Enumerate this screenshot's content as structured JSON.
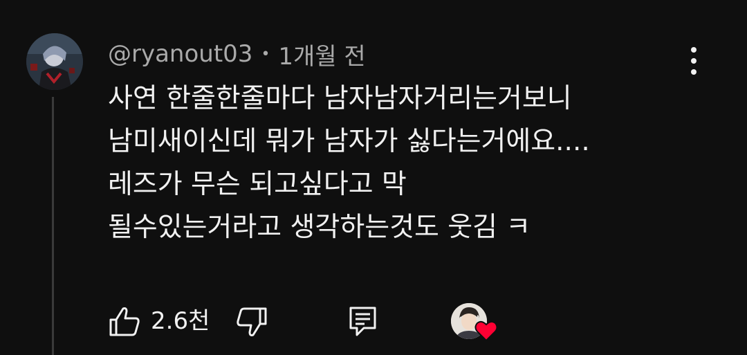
{
  "comment": {
    "author": "@ryanout03",
    "separator": "•",
    "timestamp": "1개월 전",
    "lines": [
      "사연 한줄한줄마다 남자남자거리는거보니",
      "남미새이신데 뭐가 남자가 싫다는거에요....",
      "레즈가 무슨 되고싶다고 막",
      "될수있는거라고 생각하는것도 웃김 ㅋ"
    ]
  },
  "actions": {
    "like_count": "2.6천"
  },
  "icons": {
    "avatar": "user-avatar",
    "more": "more-vert-icon",
    "like": "thumb-up-icon",
    "dislike": "thumb-down-icon",
    "reply": "comment-reply-icon",
    "creator_heart": "creator-heart-icon"
  },
  "colors": {
    "background": "#0f0f0f",
    "text": "#f1f1f1",
    "secondary_text": "#aaaaaa",
    "heart": "#ff0033"
  }
}
